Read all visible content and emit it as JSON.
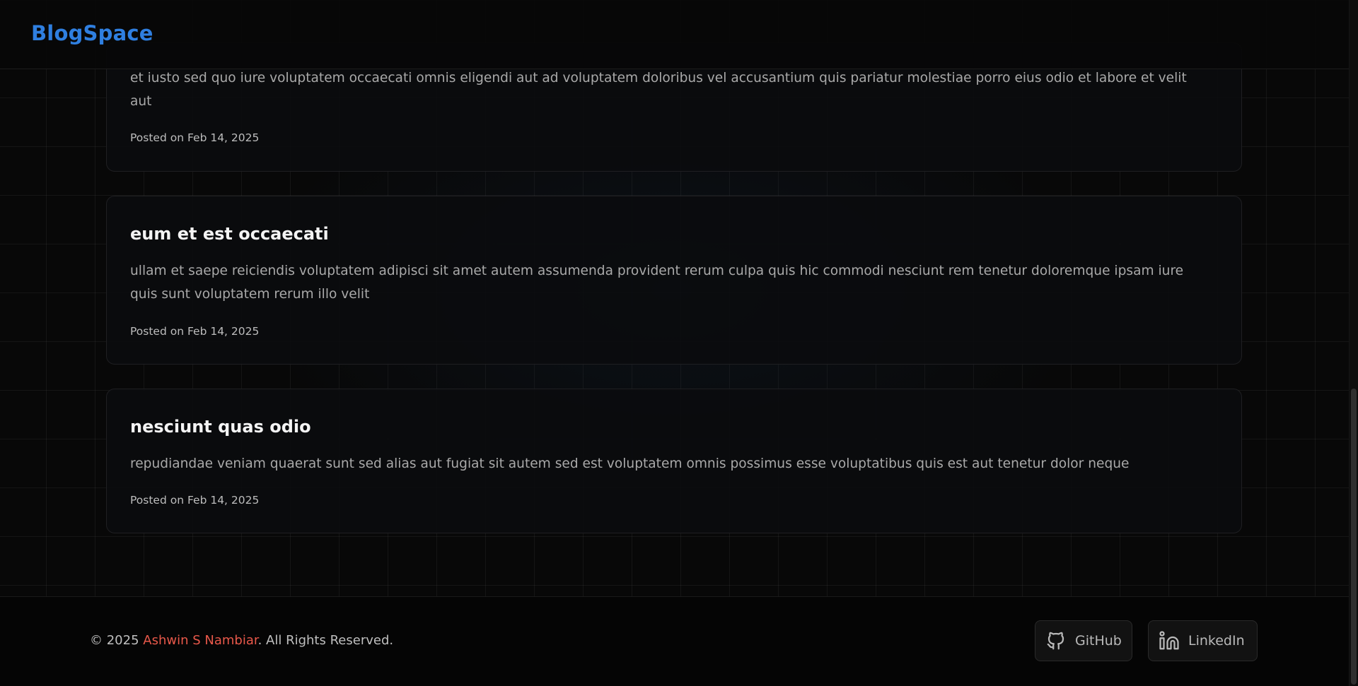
{
  "header": {
    "brand": "BlogSpace"
  },
  "posts": [
    {
      "title": "",
      "body": "et iusto sed quo iure voluptatem occaecati omnis eligendi aut ad voluptatem doloribus vel accusantium quis pariatur molestiae porro eius odio et labore et velit aut",
      "date": "Posted on Feb 14, 2025"
    },
    {
      "title": "eum et est occaecati",
      "body": "ullam et saepe reiciendis voluptatem adipisci sit amet autem assumenda provident rerum culpa quis hic commodi nesciunt rem tenetur doloremque ipsam iure quis sunt voluptatem rerum illo velit",
      "date": "Posted on Feb 14, 2025"
    },
    {
      "title": "nesciunt quas odio",
      "body": "repudiandae veniam quaerat sunt sed alias aut fugiat sit autem sed est voluptatem omnis possimus esse voluptatibus quis est aut tenetur dolor neque",
      "date": "Posted on Feb 14, 2025"
    }
  ],
  "footer": {
    "copyright_prefix": "© 2025 ",
    "author": "Ashwin S Nambiar",
    "copyright_suffix": ". All Rights Reserved.",
    "github_label": "GitHub",
    "linkedin_label": "LinkedIn",
    "github_icon": "github-icon",
    "linkedin_icon": "linkedin-icon"
  },
  "colors": {
    "brand": "#2f7fe0",
    "author_link": "#e8584a",
    "background": "#080808"
  }
}
